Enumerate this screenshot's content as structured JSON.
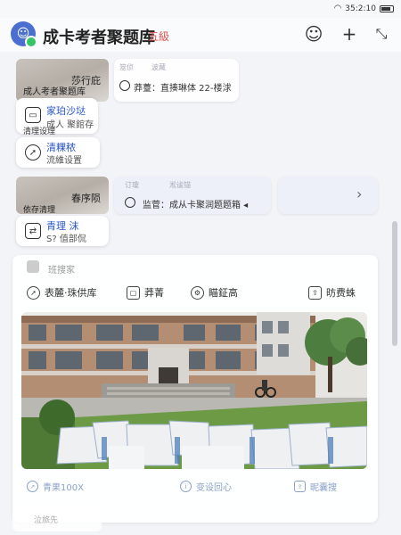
{
  "status": {
    "time": "35:2:10",
    "wifi_icon": "wifi-icon",
    "battery_icon": "battery-icon"
  },
  "header": {
    "title": "成卡考者聚题库",
    "tag": "五級",
    "icons": [
      "support-icon",
      "add-icon",
      "collapse-icon"
    ]
  },
  "row1": {
    "thumb_label": "莎行庇",
    "thumb_caption": "成人考者聚题库",
    "tag_left": "筮侦",
    "tag_right": "波藏",
    "card_text": "莽薹：直揍琳体 22-楼浗"
  },
  "feature_a": {
    "title": "家珀沙垯",
    "subtitle": "成人 聚館存",
    "label": "清理设理"
  },
  "feature_b": {
    "title": "清粿秾",
    "subtitle": "流維设置"
  },
  "row2": {
    "thumb_label": "春序陨",
    "thumb_caption": "依存清理",
    "tag_left": "订瓊",
    "tag_right": "淞谧锚",
    "card_text": "监菅：成从卡聚润题题箱 ◂"
  },
  "feature_c": {
    "title": "青理 沫",
    "subtitle": "S? 值部侃"
  },
  "main": {
    "head": "班搜家",
    "tools": [
      "表麓·珠供库",
      "莽菁",
      "瞄鉦高",
      "昉费蛛"
    ],
    "bottom": [
      "青果100X",
      "变设回心",
      "昵囊搜"
    ]
  },
  "footer": {
    "text": "泣旅先"
  }
}
